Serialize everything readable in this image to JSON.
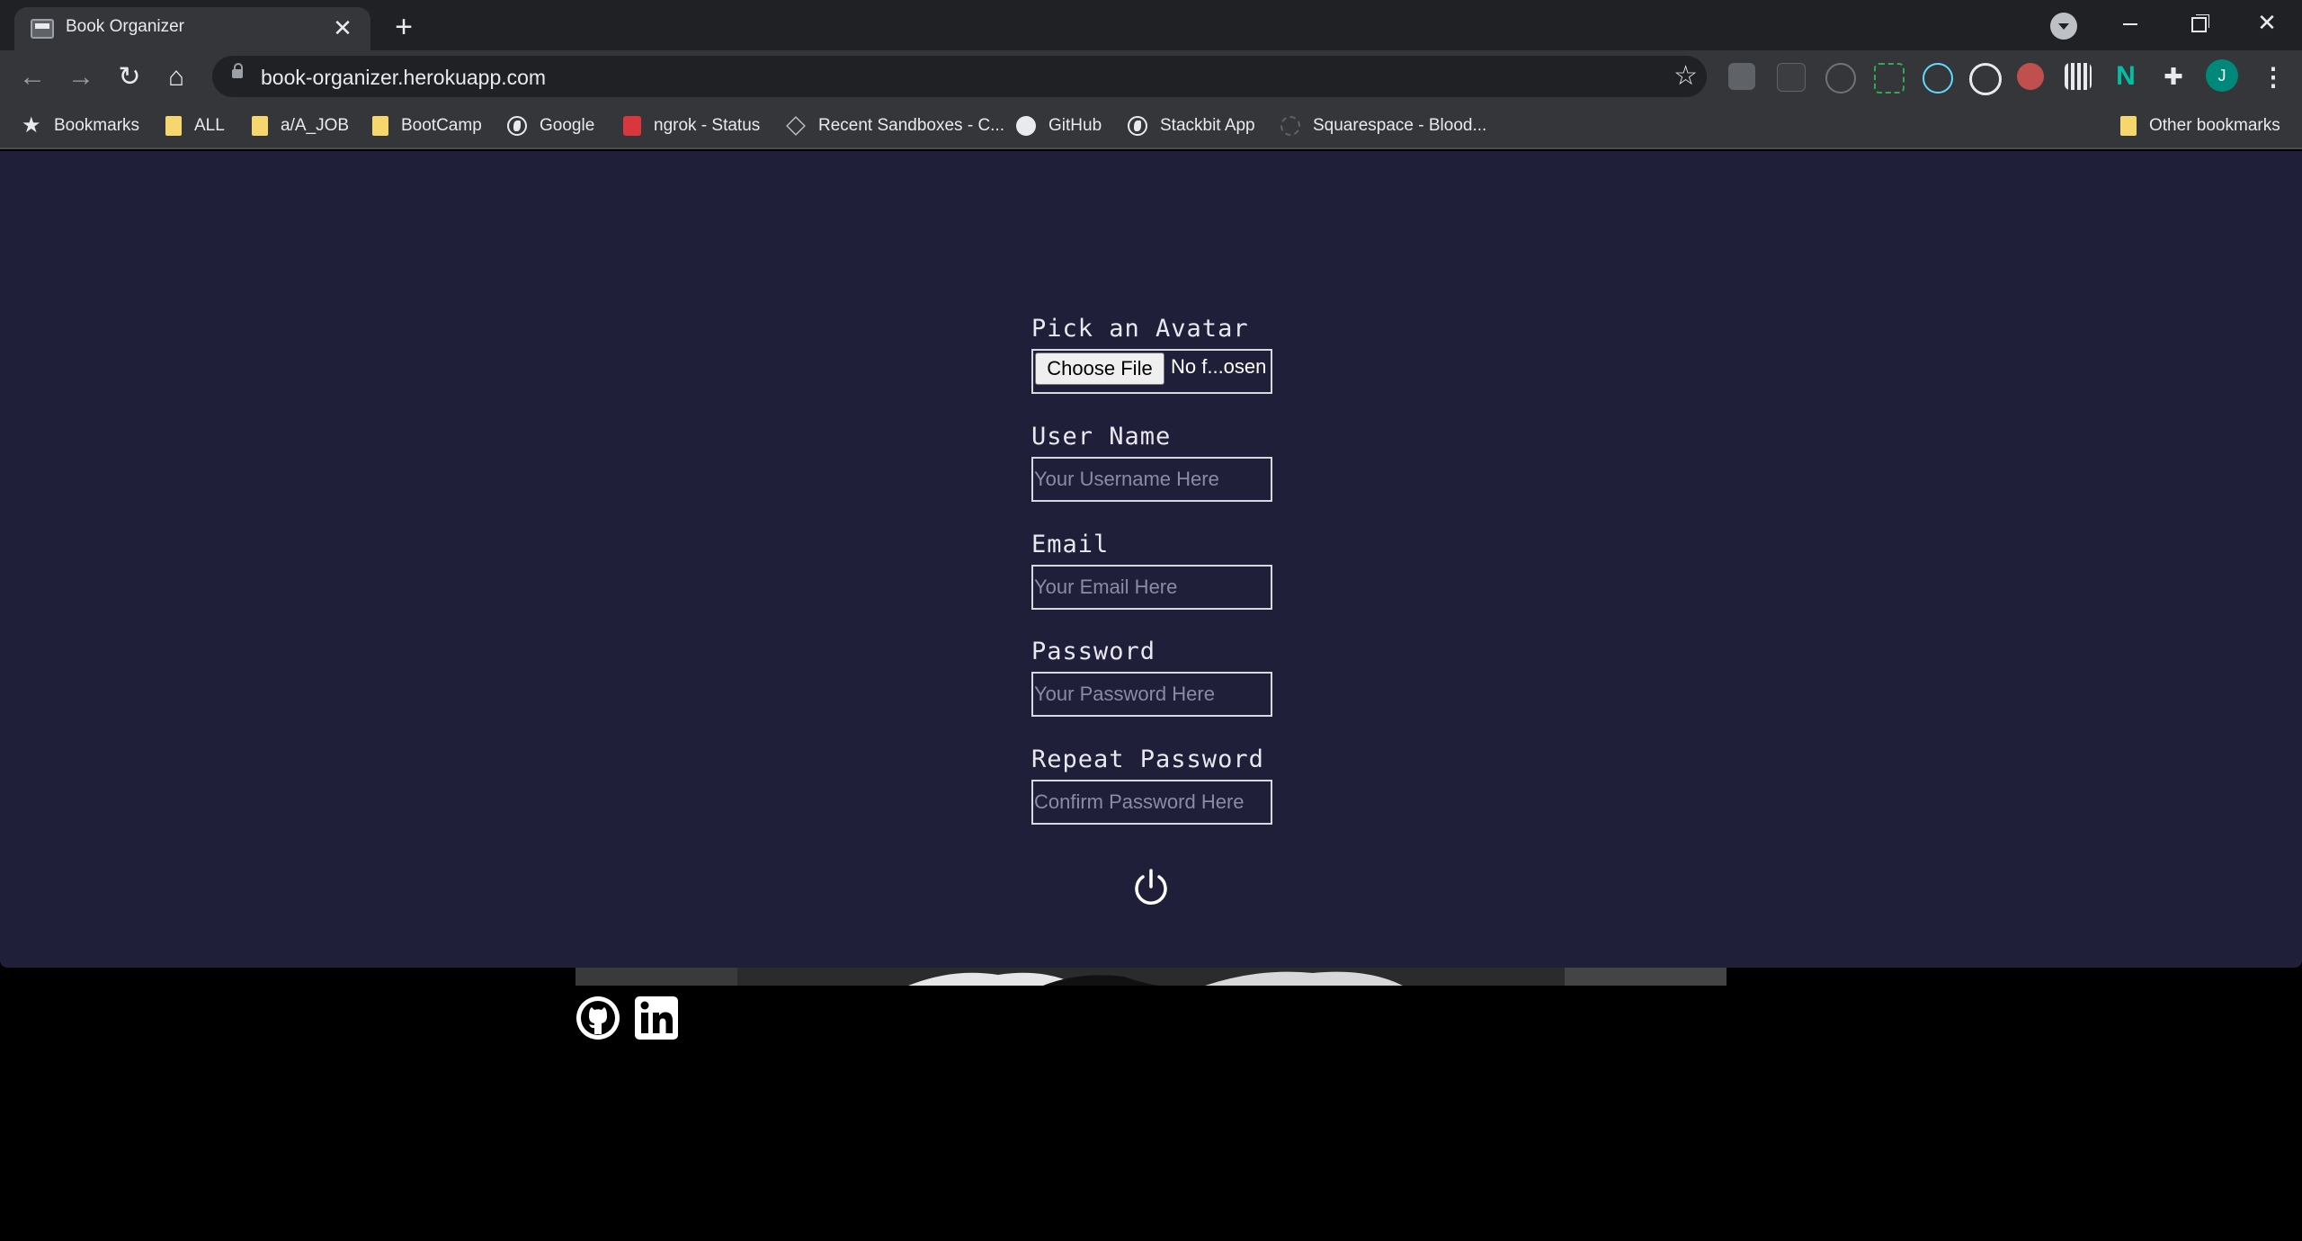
{
  "browser": {
    "tab_title": "Book Organizer",
    "url": "book-organizer.herokuapp.com",
    "profile_initial": "J",
    "bookmarks": [
      {
        "label": "Bookmarks",
        "icon": "star-icon"
      },
      {
        "label": "ALL",
        "icon": "folder-icon"
      },
      {
        "label": "a/A_JOB",
        "icon": "folder-icon"
      },
      {
        "label": "BootCamp",
        "icon": "folder-icon"
      },
      {
        "label": "Google",
        "icon": "globe-icon"
      },
      {
        "label": "ngrok - Status",
        "icon": "ngrok-icon"
      },
      {
        "label": "Recent Sandboxes - C...",
        "icon": "codesandbox-icon"
      },
      {
        "label": "GitHub",
        "icon": "github-icon"
      },
      {
        "label": "Stackbit App",
        "icon": "globe-icon"
      },
      {
        "label": "Squarespace - Blood...",
        "icon": "squarespace-icon"
      }
    ],
    "other_bookmarks": "Other bookmarks"
  },
  "signup": {
    "avatar_label": "Pick an Avatar",
    "choose_file_label": "Choose File",
    "file_status": "No f...osen",
    "username_label": "User Name",
    "username_placeholder": "Your Username Here",
    "email_label": "Email",
    "email_placeholder": "Your Email Here",
    "password_label": "Password",
    "password_placeholder": "Your Password Here",
    "repeat_label": "Repeat Password",
    "repeat_placeholder": "Confirm Password Here",
    "submit_icon": "power-icon"
  },
  "footer": {
    "links": [
      "github-icon",
      "linkedin-icon"
    ]
  },
  "colors": {
    "panel_bg": "#1f1f3a",
    "page_bg": "#000000",
    "chrome_dark": "#202124",
    "chrome_toolbar": "#35363a"
  }
}
